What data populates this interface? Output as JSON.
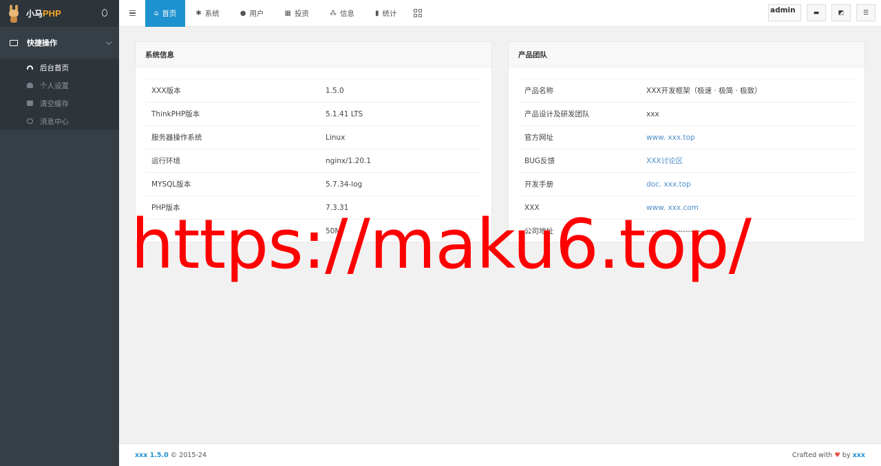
{
  "brand": {
    "name_cn": "小马",
    "name_en": "PHP"
  },
  "sidebar": {
    "group_label": "快捷操作",
    "items": [
      {
        "label": "后台首页",
        "icon": "dashboard-icon",
        "active": true
      },
      {
        "label": "个人设置",
        "icon": "user-icon",
        "active": false
      },
      {
        "label": "清空缓存",
        "icon": "trash-icon",
        "active": false
      },
      {
        "label": "消息中心",
        "icon": "chat-icon",
        "active": false
      }
    ]
  },
  "nav": {
    "tabs": [
      {
        "label": "首页",
        "icon": "home-icon",
        "active": true
      },
      {
        "label": "系统",
        "icon": "gear-icon"
      },
      {
        "label": "用户",
        "icon": "user-icon"
      },
      {
        "label": "投资",
        "icon": "bank-icon"
      },
      {
        "label": "信息",
        "icon": "share-icon"
      },
      {
        "label": "统计",
        "icon": "bar-chart-icon"
      }
    ],
    "user": "admin"
  },
  "system_info": {
    "title": "系统信息",
    "rows": [
      {
        "k": "XXX版本",
        "v": "1.5.0"
      },
      {
        "k": "ThinkPHP版本",
        "v": "5.1.41 LTS"
      },
      {
        "k": "服务器操作系统",
        "v": "Linux"
      },
      {
        "k": "运行环境",
        "v": "nginx/1.20.1"
      },
      {
        "k": "MYSQL版本",
        "v": "5.7.34-log"
      },
      {
        "k": "PHP版本",
        "v": "7.3.31"
      },
      {
        "k": "",
        "v": "50M"
      }
    ]
  },
  "team": {
    "title": "产品团队",
    "rows": [
      {
        "k": "产品名称",
        "v": "XXX开发框架（极速 · 极简 · 极致）"
      },
      {
        "k": "产品设计及研发团队",
        "v": "xxx"
      },
      {
        "k": "官方网址",
        "v": "www. xxx.top"
      },
      {
        "k": "BUG反馈",
        "v": "XXX讨论区"
      },
      {
        "k": "开发手册",
        "v": "doc. xxx.top"
      },
      {
        "k": "XXX",
        "v": "www. xxx.com"
      },
      {
        "k": "公司地址",
        "v": "--------------------------"
      }
    ]
  },
  "watermark": "https://maku6.top/",
  "footer": {
    "version": "xxx 1.5.0",
    "copy": "© 2015-24",
    "crafted": "Crafted with",
    "by": "by",
    "author": "xxx"
  },
  "colors": {
    "accent": "#1e91cf",
    "sidebar": "#363f46",
    "link": "#4f8fca",
    "watermark": "#fe0000"
  }
}
